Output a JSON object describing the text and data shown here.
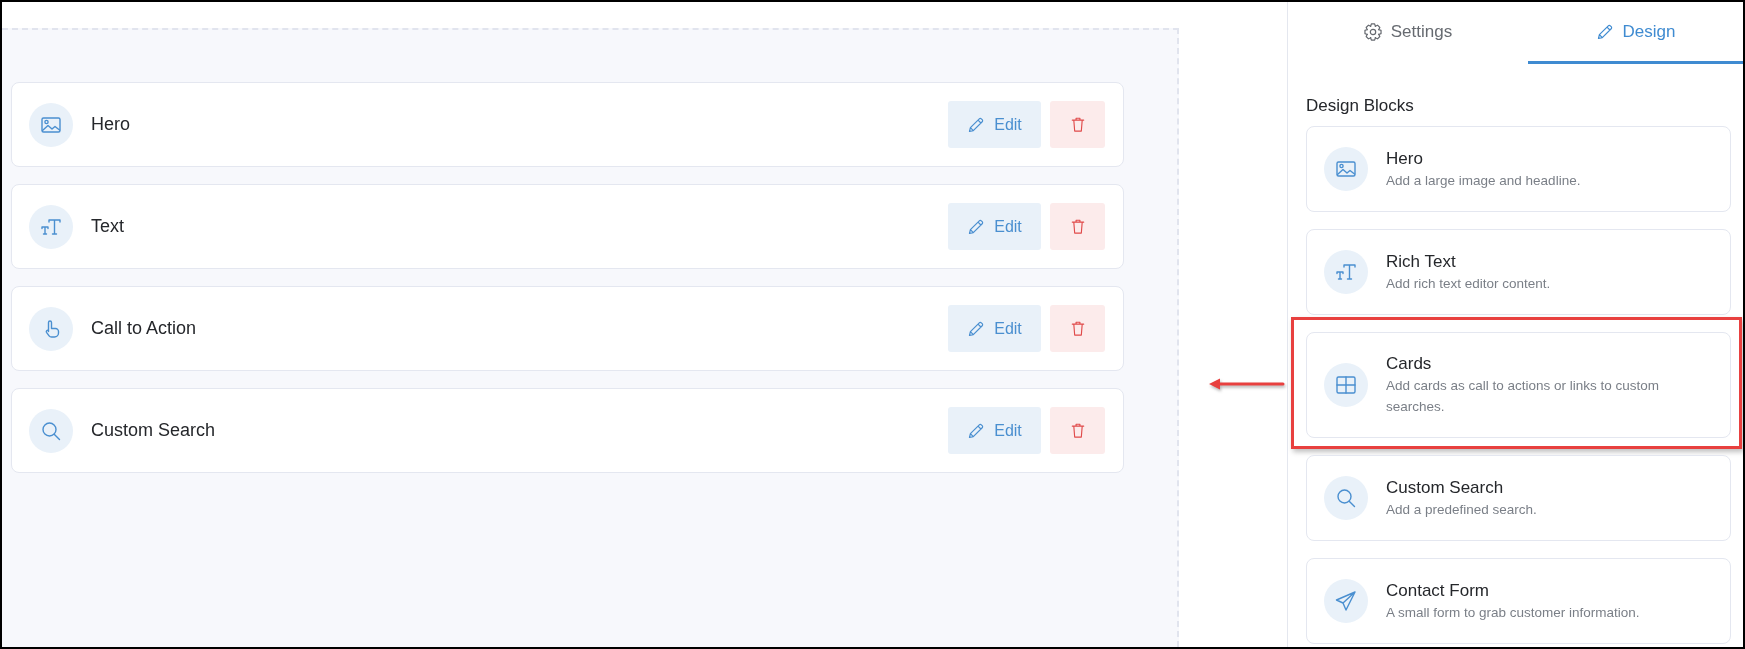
{
  "canvas": {
    "blocks": [
      {
        "kind": "hero",
        "title": "Hero",
        "edit_label": "Edit"
      },
      {
        "kind": "text",
        "title": "Text",
        "edit_label": "Edit"
      },
      {
        "kind": "action",
        "title": "Call to Action",
        "edit_label": "Edit"
      },
      {
        "kind": "search",
        "title": "Custom Search",
        "edit_label": "Edit"
      }
    ]
  },
  "panel": {
    "tabs": [
      {
        "kind": "settings",
        "label": "Settings",
        "selected": false
      },
      {
        "kind": "design",
        "label": "Design",
        "selected": true
      }
    ],
    "section_title": "Design Blocks",
    "blocks": [
      {
        "kind": "hero",
        "title": "Hero",
        "description": "Add a large image and headline.",
        "highlighted": false
      },
      {
        "kind": "text",
        "title": "Rich Text",
        "description": "Add rich text editor content.",
        "highlighted": false
      },
      {
        "kind": "cards",
        "title": "Cards",
        "description": "Add cards as call to actions or links to custom searches.",
        "highlighted": true
      },
      {
        "kind": "search",
        "title": "Custom Search",
        "description": "Add a predefined search.",
        "highlighted": false
      },
      {
        "kind": "form",
        "title": "Contact Form",
        "description": "A small form to grab customer information.",
        "highlighted": false
      }
    ]
  }
}
